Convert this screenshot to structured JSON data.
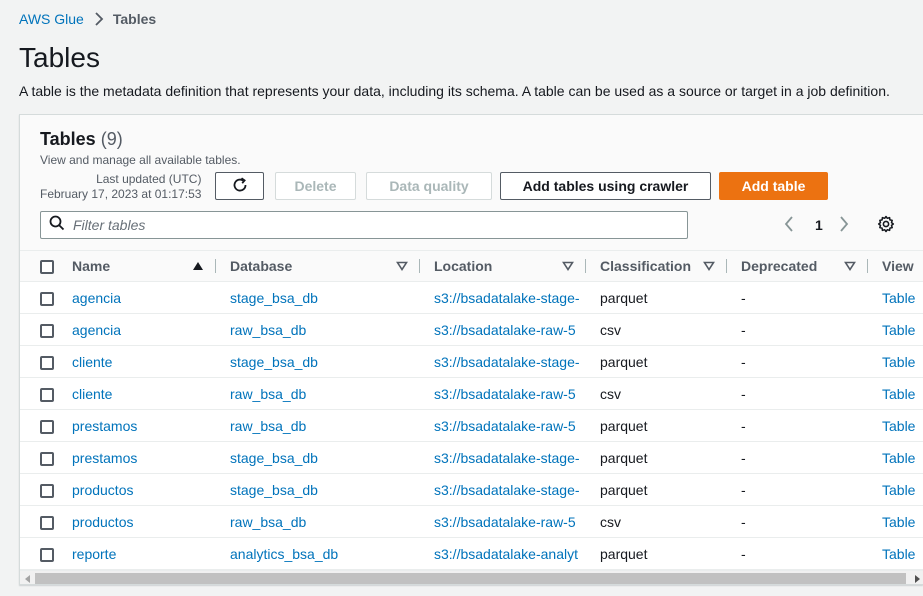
{
  "breadcrumb": {
    "root": "AWS Glue",
    "current": "Tables"
  },
  "page": {
    "title": "Tables",
    "description": "A table is the metadata definition that represents your data, including its schema. A table can be used as a source or target in a job definition."
  },
  "panel": {
    "title": "Tables",
    "count": "(9)",
    "subtitle": "View and manage all available tables.",
    "updated_label": "Last updated (UTC)",
    "updated_value": "February 17, 2023 at 01:17:53"
  },
  "actions": {
    "delete": "Delete",
    "data_quality": "Data quality",
    "add_crawler": "Add tables using crawler",
    "add_table": "Add table"
  },
  "filter": {
    "placeholder": "Filter tables"
  },
  "pagination": {
    "page": "1"
  },
  "columns": [
    "Name",
    "Database",
    "Location",
    "Classification",
    "Deprecated",
    "View"
  ],
  "rows": [
    {
      "name": "agencia",
      "database": "stage_bsa_db",
      "location": "s3://bsadatalake-stage-",
      "classification": "parquet",
      "deprecated": "-",
      "view": "Table"
    },
    {
      "name": "agencia",
      "database": "raw_bsa_db",
      "location": "s3://bsadatalake-raw-5",
      "classification": "csv",
      "deprecated": "-",
      "view": "Table"
    },
    {
      "name": "cliente",
      "database": "stage_bsa_db",
      "location": "s3://bsadatalake-stage-",
      "classification": "parquet",
      "deprecated": "-",
      "view": "Table"
    },
    {
      "name": "cliente",
      "database": "raw_bsa_db",
      "location": "s3://bsadatalake-raw-5",
      "classification": "csv",
      "deprecated": "-",
      "view": "Table"
    },
    {
      "name": "prestamos",
      "database": "raw_bsa_db",
      "location": "s3://bsadatalake-raw-5",
      "classification": "parquet",
      "deprecated": "-",
      "view": "Table"
    },
    {
      "name": "prestamos",
      "database": "stage_bsa_db",
      "location": "s3://bsadatalake-stage-",
      "classification": "parquet",
      "deprecated": "-",
      "view": "Table"
    },
    {
      "name": "productos",
      "database": "stage_bsa_db",
      "location": "s3://bsadatalake-stage-",
      "classification": "parquet",
      "deprecated": "-",
      "view": "Table"
    },
    {
      "name": "productos",
      "database": "raw_bsa_db",
      "location": "s3://bsadatalake-raw-5",
      "classification": "csv",
      "deprecated": "-",
      "view": "Table"
    },
    {
      "name": "reporte",
      "database": "analytics_bsa_db",
      "location": "s3://bsadatalake-analyt",
      "classification": "parquet",
      "deprecated": "-",
      "view": "Table"
    }
  ],
  "colors": {
    "link": "#0073bb",
    "primary": "#ec7211",
    "text": "#16191f",
    "muted": "#545b64"
  }
}
